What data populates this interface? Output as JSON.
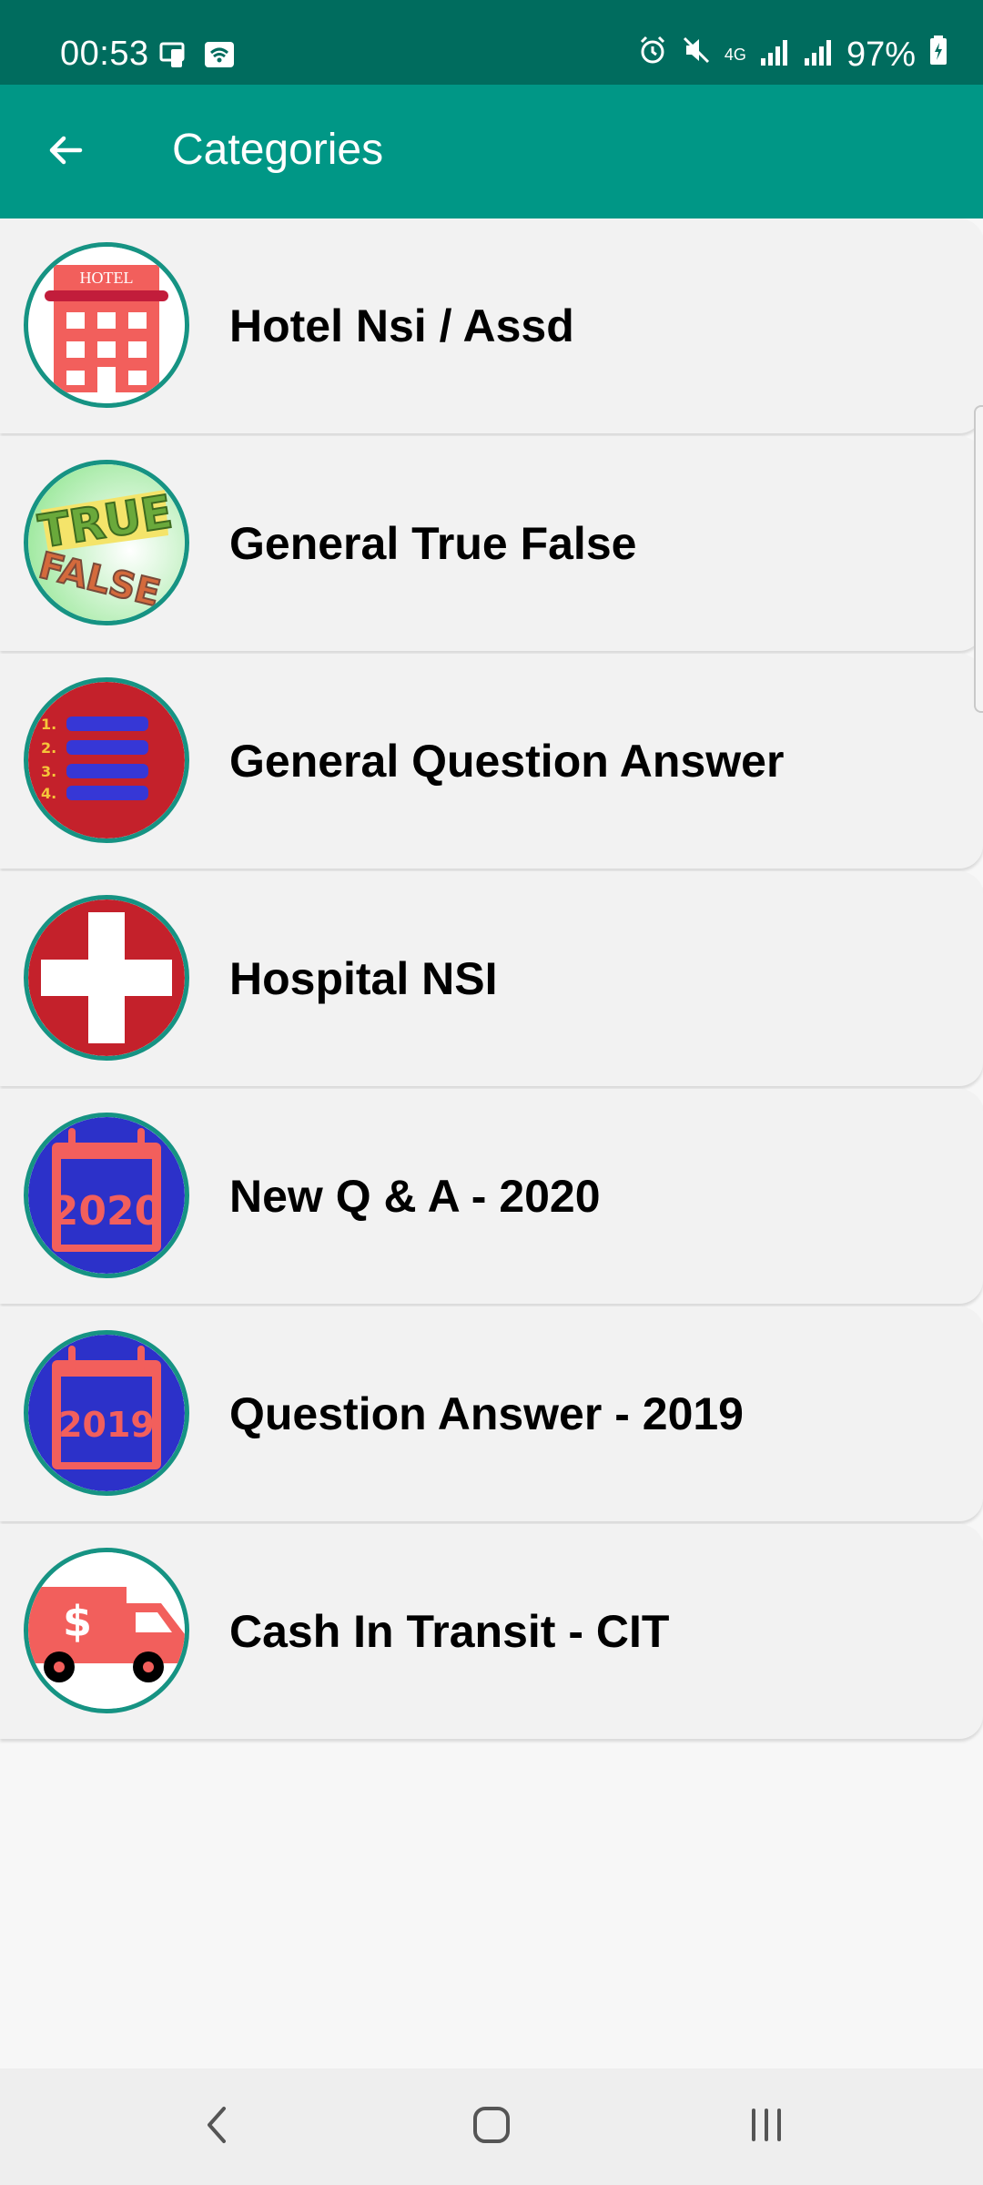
{
  "status_bar": {
    "time": "00:53",
    "battery": "97%",
    "network": "4G"
  },
  "app_bar": {
    "title": "Categories",
    "back_icon": "arrow-left-icon"
  },
  "categories": [
    {
      "label": "Hotel Nsi / Assd",
      "icon": "hotel-icon",
      "icon_text": "HOTEL"
    },
    {
      "label": "General True False",
      "icon": "true-false-icon",
      "icon_text": "TRUE FALSE"
    },
    {
      "label": "General Question Answer",
      "icon": "numbered-list-icon",
      "icon_text": "1. 2. 3. 4."
    },
    {
      "label": "Hospital NSI",
      "icon": "medical-cross-icon"
    },
    {
      "label": "New Q & A - 2020",
      "icon": "calendar-2020-icon",
      "icon_text": "2020"
    },
    {
      "label": "Question Answer - 2019",
      "icon": "calendar-2019-icon",
      "icon_text": "2019"
    },
    {
      "label": "Cash In Transit - CIT",
      "icon": "cash-truck-icon",
      "icon_text": "$"
    }
  ],
  "colors": {
    "status_bar": "#006c5e",
    "app_bar": "#009786",
    "icon_border": "#169383",
    "item_background": "#f2f2f2",
    "page_background": "#f7f7f7"
  },
  "nav_bar": {
    "back_icon": "nav-back-icon",
    "home_icon": "nav-home-icon",
    "recents_icon": "nav-recents-icon"
  }
}
